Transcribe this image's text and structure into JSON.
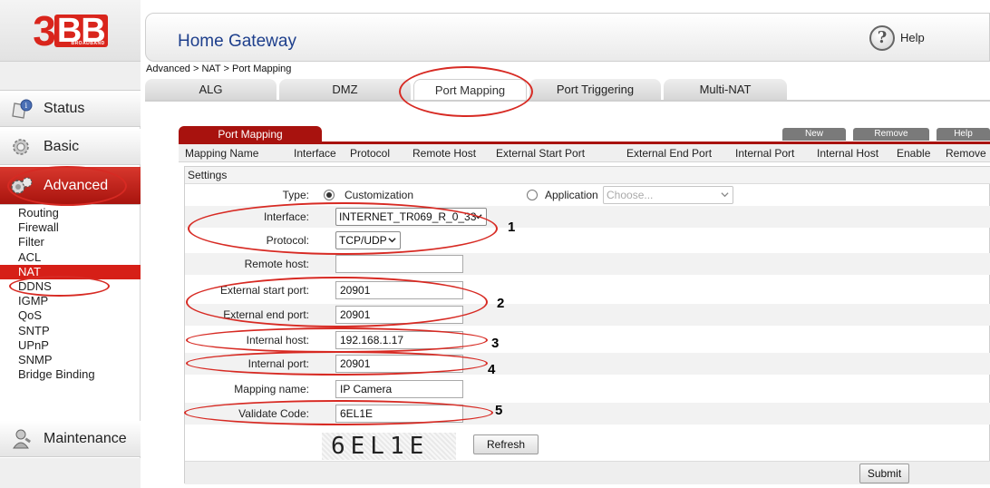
{
  "brand": {
    "logo_number": "3",
    "logo_letters": "BB",
    "logo_sub": "BROADBAND"
  },
  "header": {
    "title": "Home Gateway",
    "help_label": "Help"
  },
  "breadcrumb": "Advanced > NAT > Port Mapping",
  "sidebar": {
    "status": "Status",
    "basic": "Basic",
    "advanced": "Advanced",
    "sub_items": [
      "Routing",
      "Firewall",
      "Filter",
      "ACL",
      "NAT",
      "DDNS",
      "IGMP",
      "QoS",
      "SNTP",
      "UPnP",
      "SNMP",
      "Bridge Binding"
    ],
    "active_sub": "NAT",
    "maintenance": "Maintenance"
  },
  "tabs": [
    "ALG",
    "DMZ",
    "Port Mapping",
    "Port Triggering",
    "Multi-NAT"
  ],
  "active_tab": "Port Mapping",
  "panel": {
    "tab_label": "Port Mapping",
    "actions": {
      "new": "New",
      "remove": "Remove",
      "help": "Help"
    },
    "columns": [
      "Mapping Name",
      "Interface",
      "Protocol",
      "Remote Host",
      "External Start Port",
      "External End Port",
      "Internal Port",
      "Internal Host",
      "Enable",
      "Remove"
    ]
  },
  "settings": {
    "title": "Settings",
    "type_label": "Type:",
    "type_options": {
      "customization": "Customization",
      "application": "Application"
    },
    "type_selected": "Customization",
    "application_placeholder": "Choose...",
    "interface_label": "Interface:",
    "interface_value": "INTERNET_TR069_R_0_33",
    "protocol_label": "Protocol:",
    "protocol_value": "TCP/UDP",
    "remote_host_label": "Remote host:",
    "remote_host_value": "",
    "ext_start_label": "External start port:",
    "ext_start_value": "20901",
    "ext_end_label": "External end port:",
    "ext_end_value": "20901",
    "internal_host_label": "Internal host:",
    "internal_host_value": "192.168.1.17",
    "internal_port_label": "Internal port:",
    "internal_port_value": "20901",
    "mapping_name_label": "Mapping name:",
    "mapping_name_value": "IP Camera",
    "validate_label": "Validate Code:",
    "validate_value": "6EL1E",
    "captcha_text": "6EL1E",
    "refresh_label": "Refresh",
    "submit_label": "Submit"
  },
  "annotations": [
    "1",
    "2",
    "3",
    "4",
    "5"
  ],
  "colors": {
    "brand_red": "#d9251c",
    "title_blue": "#1e3f8c",
    "annotation_red": "#d72a23"
  }
}
